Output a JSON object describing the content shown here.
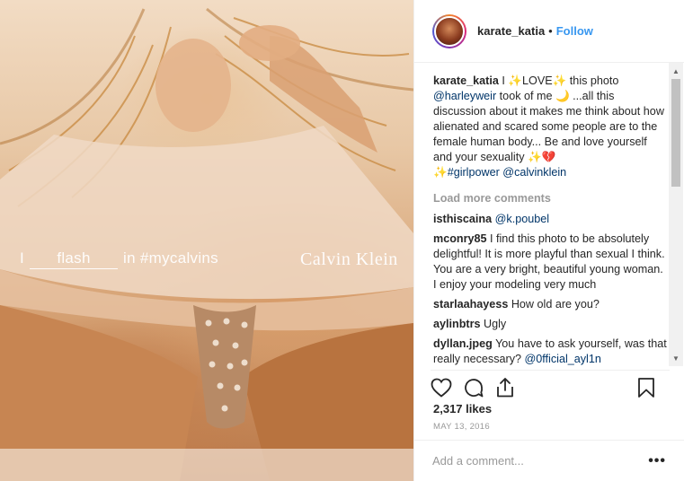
{
  "photo": {
    "overlay_prefix": "I",
    "overlay_blank": "flash",
    "overlay_suffix": "in #mycalvins",
    "overlay_brand": "Calvin Klein"
  },
  "header": {
    "username": "karate_katia",
    "separator": "•",
    "follow_label": "Follow"
  },
  "caption": {
    "username": "karate_katia",
    "t1": " I ",
    "spark": "✨",
    "t2": "LOVE",
    "t3": " this photo ",
    "mention1": "@harleyweir",
    "t4": " took of me ",
    "moon": "🌙",
    "t5": " ...all this discussion about it makes me think about how alienated and scared some people are to the female human body... Be and love yourself and your sexuality ",
    "heart": "💔",
    "hashtag": "#girlpower",
    "mention2": "@calvinklein"
  },
  "load_more_label": "Load more comments",
  "comments": [
    {
      "user": "isthiscaina",
      "text": "",
      "mention": "@k.poubel"
    },
    {
      "user": "mconry85",
      "text": "I find this photo to be absolutely delightful! It is more playful than sexual I think. You are a very bright, beautiful young woman. I enjoy your modeling very much",
      "mention": ""
    },
    {
      "user": "starlaahayess",
      "text": "How old are you?",
      "mention": ""
    },
    {
      "user": "aylinbtrs",
      "text": "Ugly",
      "mention": ""
    },
    {
      "user": "dyllan.jpeg",
      "text": "You have to ask yourself, was that really necessary?",
      "mention": "@0fficial_ayl1n"
    }
  ],
  "icons": {
    "like": "heart-icon",
    "comment": "comment-bubble-icon",
    "share": "share-icon",
    "save": "bookmark-icon"
  },
  "likes_label": "2,317 likes",
  "date_label": "MAY 13, 2016",
  "add_comment_placeholder": "Add a comment...",
  "more_options_label": "•••",
  "colors": {
    "link": "#003569",
    "follow": "#3897f0",
    "muted": "#999999"
  }
}
